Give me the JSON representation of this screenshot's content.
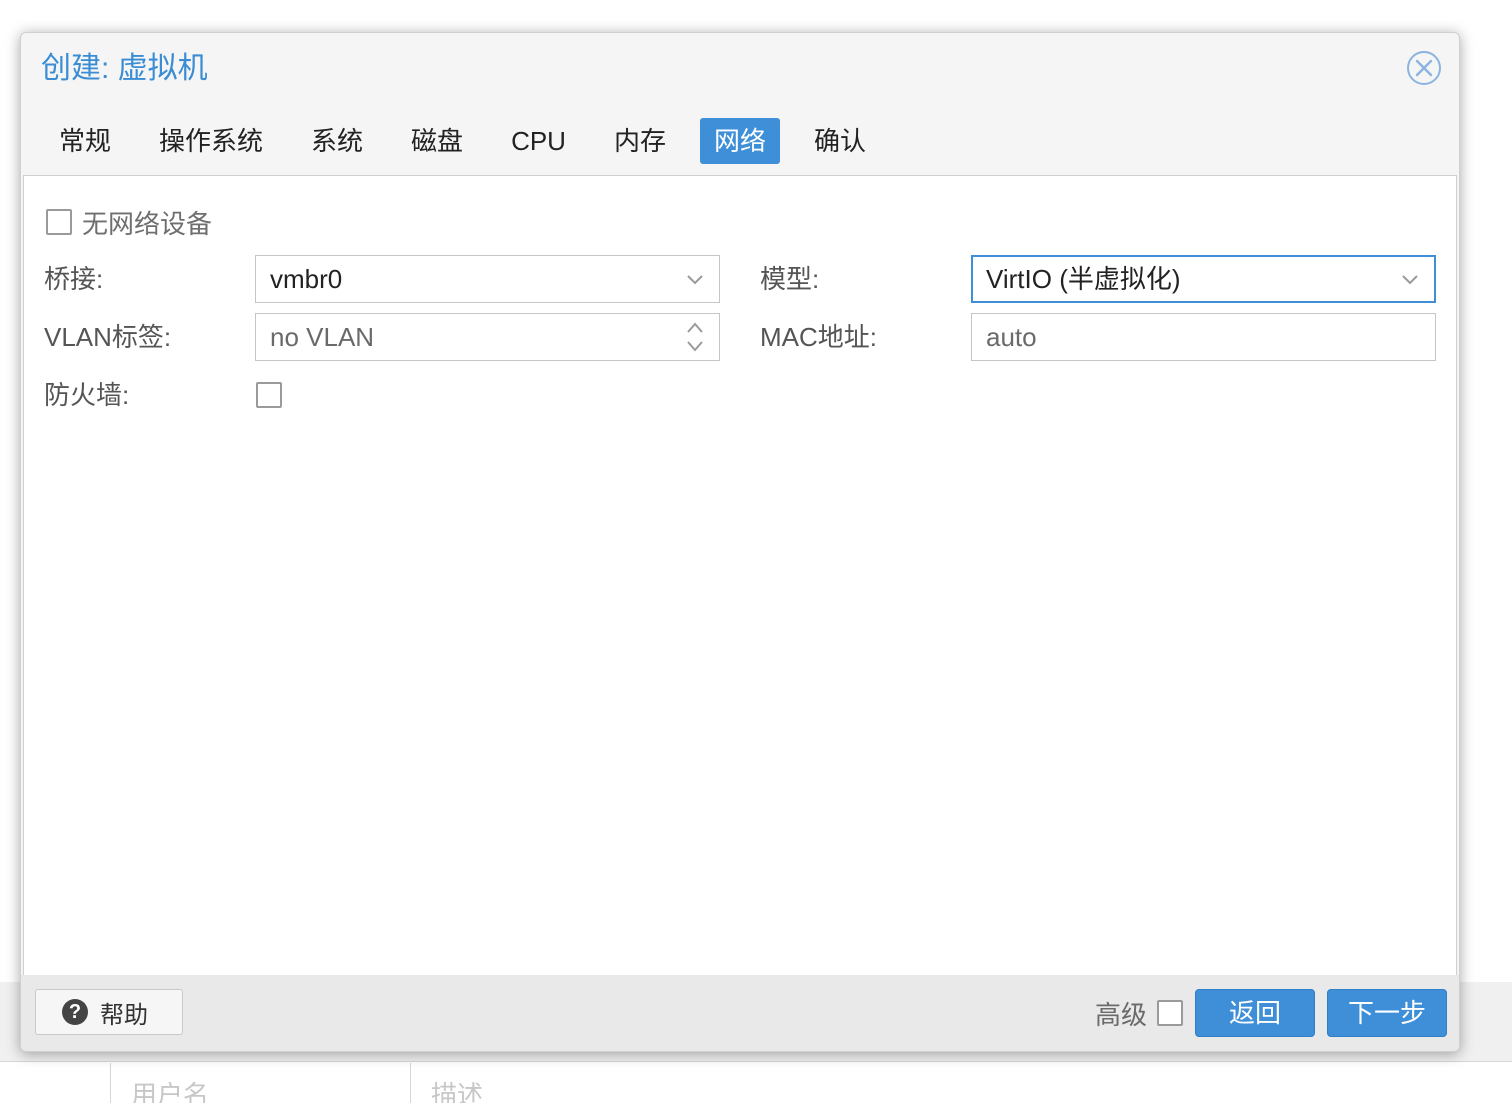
{
  "dialog": {
    "title": "创建: 虚拟机"
  },
  "tabs": [
    {
      "label": "常规"
    },
    {
      "label": "操作系统"
    },
    {
      "label": "系统"
    },
    {
      "label": "磁盘"
    },
    {
      "label": "CPU"
    },
    {
      "label": "内存"
    },
    {
      "label": "网络",
      "active": true
    },
    {
      "label": "确认"
    }
  ],
  "network": {
    "no_device_label": "无网络设备",
    "no_device_checked": false,
    "bridge_label": "桥接:",
    "bridge_value": "vmbr0",
    "model_label": "模型:",
    "model_value": "VirtIO (半虚拟化)",
    "vlan_label": "VLAN标签:",
    "vlan_value": "no VLAN",
    "mac_label": "MAC地址:",
    "mac_value": "auto",
    "firewall_label": "防火墙:",
    "firewall_checked": false
  },
  "footer": {
    "help_label": "帮助",
    "help_icon": "?",
    "advanced_label": "高级",
    "advanced_checked": false,
    "back_label": "返回",
    "next_label": "下一步"
  },
  "background": {
    "col1": "用户名",
    "col2": "描述"
  },
  "colors": {
    "accent": "#3f8fd8",
    "title": "#3a8dd4"
  }
}
